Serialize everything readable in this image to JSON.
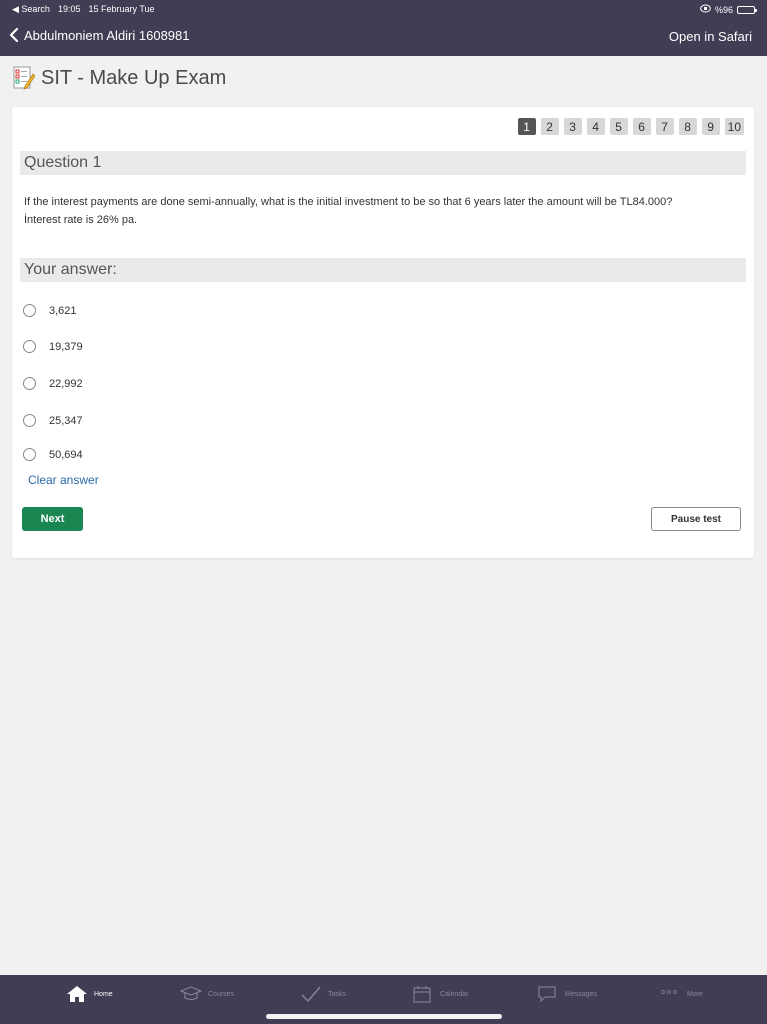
{
  "statusbar": {
    "back_app": "◀ Search",
    "time": "19:05",
    "date": "15 February Tue",
    "battery_text": "%96"
  },
  "navbar": {
    "back_label": "Abdulmoniem Aldiri 1608981",
    "open_label": "Open in Safari"
  },
  "page": {
    "title": "SIT - Make Up Exam"
  },
  "pager": {
    "pages": [
      "1",
      "2",
      "3",
      "4",
      "5",
      "6",
      "7",
      "8",
      "9",
      "10"
    ],
    "current": "1"
  },
  "question": {
    "heading": "Question 1",
    "line1": "If the interest payments are done semi-annually, what is the initial investment to be so that 6 years later the amount will be TL84.000?",
    "line2": "İnterest rate is 26% pa."
  },
  "answer": {
    "heading": "Your answer:",
    "options": [
      "3,621",
      "19,379",
      "22,992",
      "25,347",
      "50,694"
    ],
    "clear_label": "Clear answer"
  },
  "actions": {
    "next_label": "Next",
    "pause_label": "Pause test"
  },
  "tabbar": {
    "items": [
      {
        "label": "Home",
        "icon": "home-icon"
      },
      {
        "label": "Courses",
        "icon": "graduation-cap-icon"
      },
      {
        "label": "Tasks",
        "icon": "checkmark-icon"
      },
      {
        "label": "Calendar",
        "icon": "calendar-icon"
      },
      {
        "label": "Messages",
        "icon": "speech-bubble-icon"
      },
      {
        "label": "More",
        "icon": "ellipsis-icon"
      }
    ],
    "active": "Home"
  },
  "colors": {
    "header_bg": "#423d55",
    "next_button": "#1a8752",
    "link": "#2a6aa8"
  }
}
